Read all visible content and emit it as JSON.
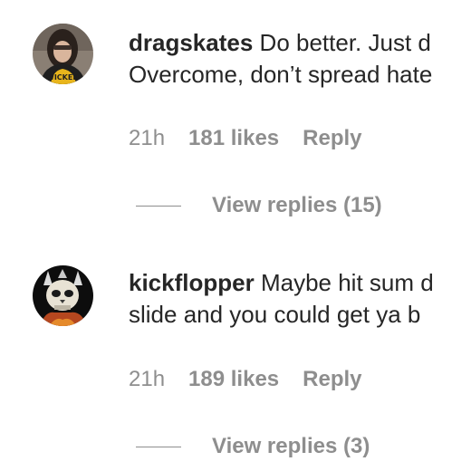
{
  "comments": [
    {
      "username": "dragskates",
      "text_line1": "Do better. Just d",
      "text_line2": "Overcome, don’t spread hate",
      "time": "21h",
      "likes": "181 likes",
      "reply_label": "Reply",
      "view_replies": "View replies (15)",
      "avatar_icon": "profile-photo-person-yellow-shirt"
    },
    {
      "username": "kickflopper",
      "text_line1": "Maybe hit sum d",
      "text_line2": "slide and you could get ya b",
      "time": "21h",
      "likes": "189 likes",
      "reply_label": "Reply",
      "view_replies": "View replies (3)",
      "avatar_icon": "profile-photo-skull-graphic"
    }
  ],
  "colors": {
    "primary_text": "#262626",
    "secondary_text": "#8e8e8e",
    "background": "#ffffff"
  }
}
